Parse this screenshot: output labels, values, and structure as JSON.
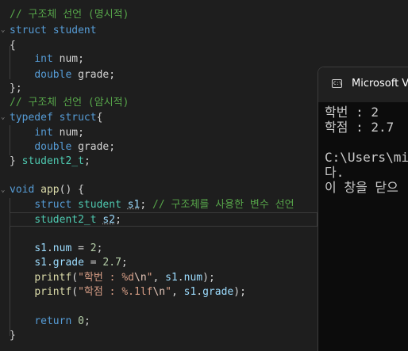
{
  "code": {
    "c1": "// 구조체 선언 (명시적)",
    "kw_struct": "struct",
    "name_student": "student",
    "open_brace": "{",
    "type_int": "int",
    "var_num": "num",
    "semi": ";",
    "type_double": "double",
    "var_grade": "grade",
    "close_brace_semi": "};",
    "c2": "// 구조체 선언 (암시적)",
    "kw_typedef": "typedef",
    "struct_open": "{",
    "close_brace": "}",
    "name_student2_t": "student2_t",
    "kw_void": "void",
    "fn_app": "app",
    "app_sig_rest": "() {",
    "var_s1": "s1",
    "c3": "// 구조체를 사용한 변수 선언",
    "var_s2": "s2",
    "assign_num_value": "2",
    "assign_grade_value": "2.7",
    "fn_printf": "printf",
    "fmt1_a": "\"학번 : %d",
    "fmt1_esc": "\\n",
    "fmt2_a": "\"학점 : %.1lf",
    "fmt2_esc": "\\n",
    "quote": "\"",
    "kw_return": "return",
    "ret_value": "0",
    "fn_close": "}"
  },
  "console": {
    "title": "Microsoft Vis",
    "icon": "C:\\",
    "lines": [
      "학번 : 2",
      "학점 : 2.7",
      "",
      "C:\\Users\\mic",
      "다.",
      "이 창을 닫으"
    ]
  }
}
